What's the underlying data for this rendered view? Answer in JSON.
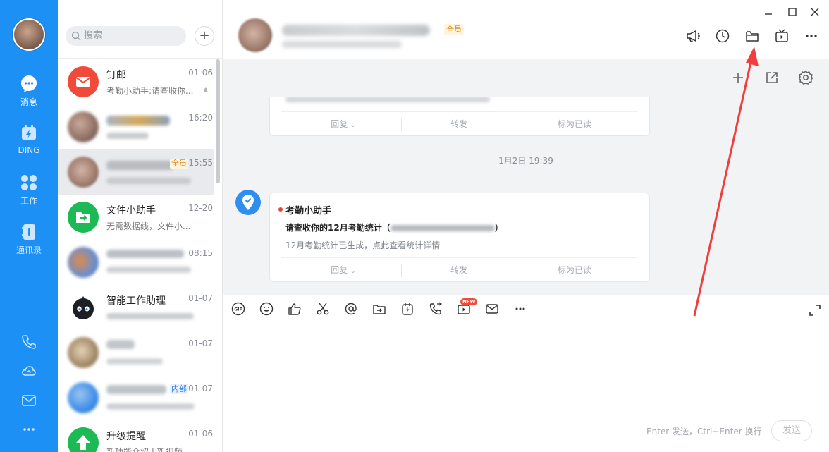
{
  "rail": {
    "items": [
      {
        "label": "消息",
        "icon": "chat-bubble-icon",
        "active": true
      },
      {
        "label": "DING",
        "icon": "ding-icon",
        "active": false
      },
      {
        "label": "工作",
        "icon": "grid-apps-icon",
        "active": false
      },
      {
        "label": "通讯录",
        "icon": "contacts-book-icon",
        "active": false
      }
    ],
    "bottom_icons": [
      "phone-icon",
      "cloud-icon",
      "mail-icon",
      "more-dots-icon"
    ]
  },
  "search": {
    "placeholder": "搜索"
  },
  "conversations": [
    {
      "name": "钉邮",
      "time": "01-06",
      "preview": "考勤小助手:请查收你...",
      "avatar_color": "#f04b3a",
      "avatar": "mail-envelope-icon"
    },
    {
      "name": "",
      "time": "16:20",
      "preview": "",
      "blurred": true
    },
    {
      "name": "",
      "time": "15:55",
      "preview": "",
      "blurred": true,
      "tag": "全员",
      "selected": true
    },
    {
      "name": "文件小助手",
      "time": "12-20",
      "preview": "无需数据线，文件小...",
      "avatar_color": "#1db954",
      "avatar": "file-transfer-icon"
    },
    {
      "name": "",
      "time": "08:15",
      "preview": "",
      "blurred": true
    },
    {
      "name": "智能工作助理",
      "time": "01-07",
      "preview": "",
      "avatar": "robot-icon"
    },
    {
      "name": "",
      "time": "01-07",
      "preview": "",
      "blurred": true
    },
    {
      "name": "",
      "time": "01-07",
      "preview": "",
      "blurred": true,
      "tag": "内部"
    },
    {
      "name": "升级提醒",
      "time": "01-06",
      "preview": "新功能介绍 | 新视频",
      "avatar_color": "#1db954",
      "avatar": "upgrade-arrow-icon"
    }
  ],
  "chat": {
    "header_tag": "全员",
    "header_icons": [
      "megaphone-icon",
      "clock-history-icon",
      "folder-icon",
      "tv-live-icon",
      "more-dots-icon"
    ],
    "window_controls": [
      "minimize",
      "maximize",
      "close"
    ],
    "subbar_icons": [
      "plus-icon",
      "open-external-icon",
      "settings-gear-icon"
    ],
    "card_actions": {
      "reply": "回复",
      "forward": "转发",
      "mark_read": "标为已读"
    },
    "time_divider": "1月2日 19:39",
    "message": {
      "sender": "考勤小助手",
      "line": "请查收你的12月考勤统计（",
      "line_end": "）",
      "desc": "12月考勤统计已生成，点此查看统计详情"
    }
  },
  "composer": {
    "tools": [
      "gif-icon",
      "emoji-icon",
      "thumbs-up-icon",
      "scissors-icon",
      "at-icon",
      "forward-icon",
      "ding-icon",
      "call-icon",
      "video-live-icon",
      "mail-icon",
      "more-dots-icon"
    ],
    "new_badge": "NEW",
    "hint": "Enter 发送，Ctrl+Enter 换行",
    "send_label": "发送"
  },
  "annotation": {
    "arrow_color": "#ef3e3e"
  }
}
